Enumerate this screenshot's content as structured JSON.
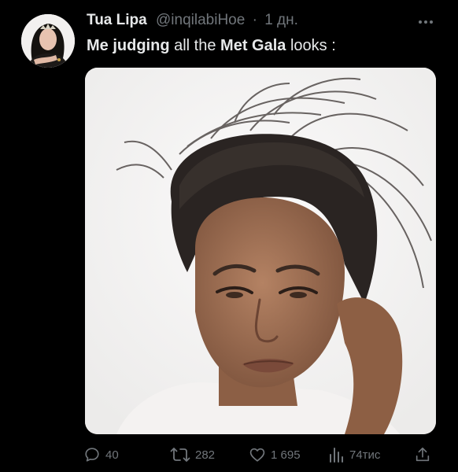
{
  "author": {
    "display_name": "Tua Lipa",
    "handle": "@inqilabiHoe",
    "separator": "·",
    "time": "1 дн."
  },
  "tweet": {
    "text_parts": [
      "Me judging",
      " all the ",
      "Met Gala",
      " looks :"
    ]
  },
  "actions": {
    "reply_count": "40",
    "retweet_count": "282",
    "like_count": "1 695",
    "views_count": "74тис"
  },
  "icons": {
    "more": "more-dots-icon",
    "reply": "reply-icon",
    "retweet": "retweet-icon",
    "like": "heart-icon",
    "views": "views-chart-icon",
    "share": "share-icon"
  },
  "colors": {
    "background": "#000000",
    "text_primary": "#e7e9ea",
    "text_secondary": "#71767b"
  }
}
